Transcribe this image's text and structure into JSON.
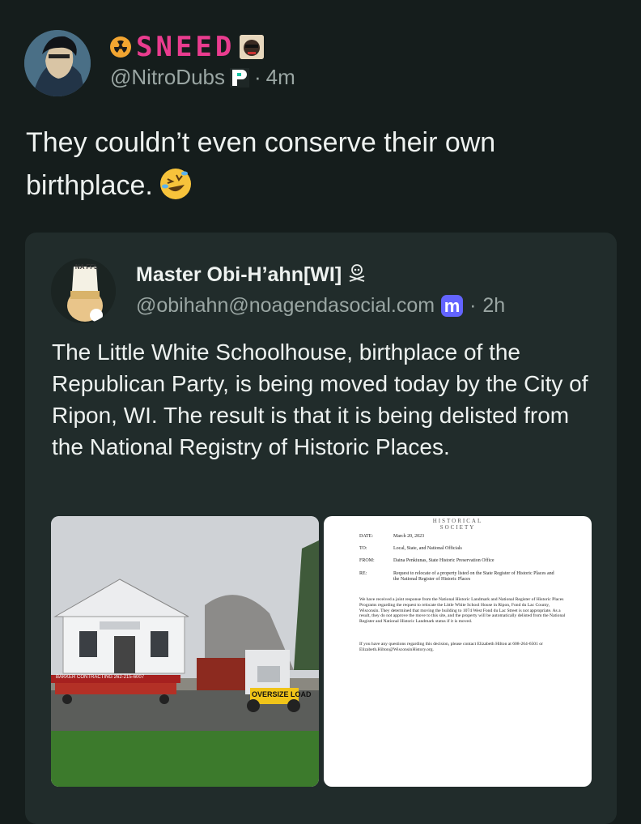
{
  "post": {
    "display_name": "SNEED",
    "handle": "@NitroDubs",
    "separator": "·",
    "time": "4m",
    "text": "They couldn’t even conserve their own birthplace."
  },
  "quoted": {
    "display_name": "Master Obi-H’ahn[WI]",
    "handle": "@obihahn@noagendasocial.com",
    "separator": "·",
    "time": "2h",
    "text": "The Little White Schoolhouse, birthplace of the Republican Party, is being moved today by the City of Ripon, WI. The result is that it is being delisted from the National Registry of Historic Places.",
    "avatar_text": "NA FFL"
  },
  "media": {
    "photo": {
      "truck_sign": "OVERSIZE LOAD",
      "mover_text": "BAKKER CONTRACTING 262-215-6007"
    },
    "document": {
      "header_line1": "HISTORICAL",
      "header_line2": "SOCIETY",
      "fields": [
        {
          "key": "DATE:",
          "value": "March 20, 2023"
        },
        {
          "key": "TO:",
          "value": "Local, State, and National Officials"
        },
        {
          "key": "FROM:",
          "value": "Daina Penkiunas, State Historic Preservation Office"
        },
        {
          "key": "RE:",
          "value": "Request to relocate of a property listed on the State Register of Historic Places and the National Register of Historic Places"
        }
      ],
      "paragraph1": "We have received a joint response from the National Historic Landmark and National Register of Historic Places Programs regarding the request to relocate the Little White School House in Ripon, Fond du Lac County, Wisconsin. They determined that moving the building to 1074 West Fond du Lac Street is not appropriate. As a result, they do not approve the move to this site, and the property will be automatically delisted from the National Register and National Historic Landmark status if it is moved.",
      "paragraph2": "If you have any questions regarding this decision, please contact Elizabeth Hilton at 608-264-6501 or Elizabeth.Hilton@WisconsinHistory.org."
    }
  },
  "colors": {
    "background": "#151d1c",
    "card": "#212c2b",
    "display_name": "#ea3c8f",
    "muted": "#9aa6a3",
    "mastodon": "#6364ff"
  }
}
